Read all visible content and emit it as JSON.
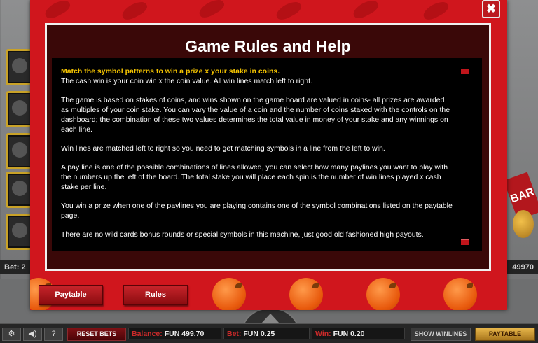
{
  "modal": {
    "title": "Game Rules and Help",
    "close_label": "✖",
    "paragraphs": [
      {
        "highlight": "Match the symbol patterns to win a prize x your stake in coins.",
        "text": "The cash win is your coin win x the coin value. All win lines match left to right."
      },
      "The game is based on stakes of coins, and wins shown on the game board are valued in coins- all prizes are awarded as multiples of your coin stake. You can vary the value of a coin and the number of coins staked with the controls on the dashboard; the combination of these two values determines the total value in money of your stake and any winnings on each line.",
      "Win lines are matched left to right so you need to get matching symbols in a line from the left to win.",
      "A pay line is one of the possible combinations of lines allowed, you can select how many paylines you want to play with the numbers up the left of the board. The total stake you will place each spin is the number of win lines played x cash stake per line.",
      "You win a prize when one of the paylines you are playing contains one of the symbol combinations listed on the paytable page.",
      "There are no wild cards bonus rounds or special symbols in this machine, just good old fashioned high payouts."
    ],
    "buttons": {
      "paytable": "Paytable",
      "rules": "Rules"
    }
  },
  "background": {
    "bet_left": "Bet: 2",
    "total_right": "49970",
    "bar_sign": "BAR"
  },
  "bottom_bar": {
    "settings_icon": "gear-icon",
    "sound_icon": "speaker-icon",
    "help_label": "?",
    "reset_bets": "RESET BETS",
    "balance_label": "Balance:",
    "balance_value": "FUN 499.70",
    "bet_label": "Bet:",
    "bet_value": "FUN 0.25",
    "win_label": "Win:",
    "win_value": "FUN 0.20",
    "show_winlines": "SHOW WINLINES",
    "paytable": "PAYTABLE"
  },
  "colors": {
    "modal_red": "#d0161d",
    "highlight_yellow": "#f5c400",
    "label_red": "#cc2a2a",
    "gold": "#c9a227"
  }
}
